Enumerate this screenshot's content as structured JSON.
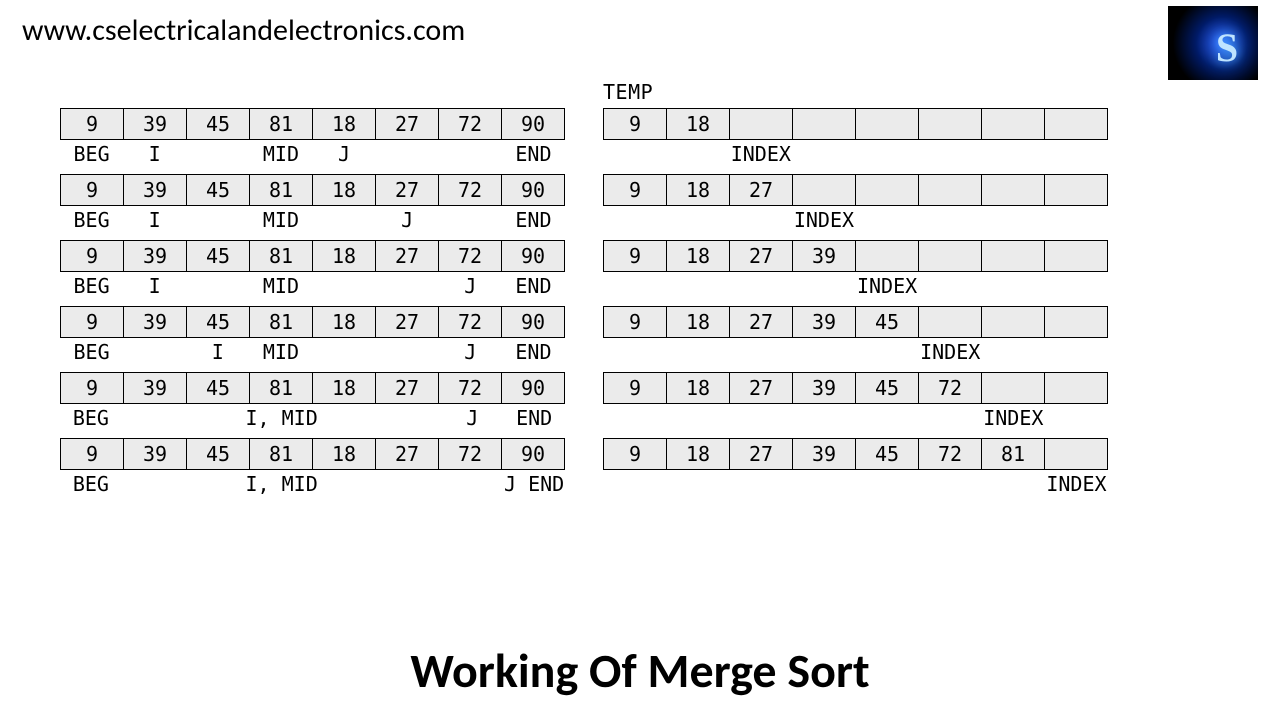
{
  "url": "www.cselectricalandelectronics.com",
  "logo_letter": "S",
  "temp_label": "TEMP",
  "title": "Working Of Merge Sort",
  "source_array": [
    "9",
    "39",
    "45",
    "81",
    "18",
    "27",
    "72",
    "90"
  ],
  "steps": [
    {
      "src_labels": [
        "BEG",
        "I",
        "",
        "MID",
        "J",
        "",
        "",
        "END"
      ],
      "temp": [
        "9",
        "18",
        "",
        "",
        "",
        "",
        "",
        ""
      ],
      "temp_labels": [
        "",
        "",
        "INDEX",
        "",
        "",
        "",
        "",
        ""
      ]
    },
    {
      "src_labels": [
        "BEG",
        "I",
        "",
        "MID",
        "",
        "J",
        "",
        "END"
      ],
      "temp": [
        "9",
        "18",
        "27",
        "",
        "",
        "",
        "",
        ""
      ],
      "temp_labels": [
        "",
        "",
        "",
        "INDEX",
        "",
        "",
        "",
        ""
      ]
    },
    {
      "src_labels": [
        "BEG",
        "I",
        "",
        "MID",
        "",
        "",
        "J",
        "END"
      ],
      "temp": [
        "9",
        "18",
        "27",
        "39",
        "",
        "",
        "",
        ""
      ],
      "temp_labels": [
        "",
        "",
        "",
        "",
        "INDEX",
        "",
        "",
        ""
      ]
    },
    {
      "src_labels": [
        "BEG",
        "",
        "I",
        "MID",
        "",
        "",
        "J",
        "END"
      ],
      "temp": [
        "9",
        "18",
        "27",
        "39",
        "45",
        "",
        "",
        ""
      ],
      "temp_labels": [
        "",
        "",
        "",
        "",
        "",
        "INDEX",
        "",
        ""
      ]
    },
    {
      "src_labels": [
        "BEG",
        "",
        "",
        "I, MID",
        "",
        "",
        "J",
        "END"
      ],
      "temp": [
        "9",
        "18",
        "27",
        "39",
        "45",
        "72",
        "",
        ""
      ],
      "temp_labels": [
        "",
        "",
        "",
        "",
        "",
        "",
        "INDEX",
        ""
      ]
    },
    {
      "src_labels": [
        "BEG",
        "",
        "",
        "I, MID",
        "",
        "",
        "",
        "J END"
      ],
      "temp": [
        "9",
        "18",
        "27",
        "39",
        "45",
        "72",
        "81",
        ""
      ],
      "temp_labels": [
        "",
        "",
        "",
        "",
        "",
        "",
        "",
        "INDEX"
      ]
    }
  ]
}
